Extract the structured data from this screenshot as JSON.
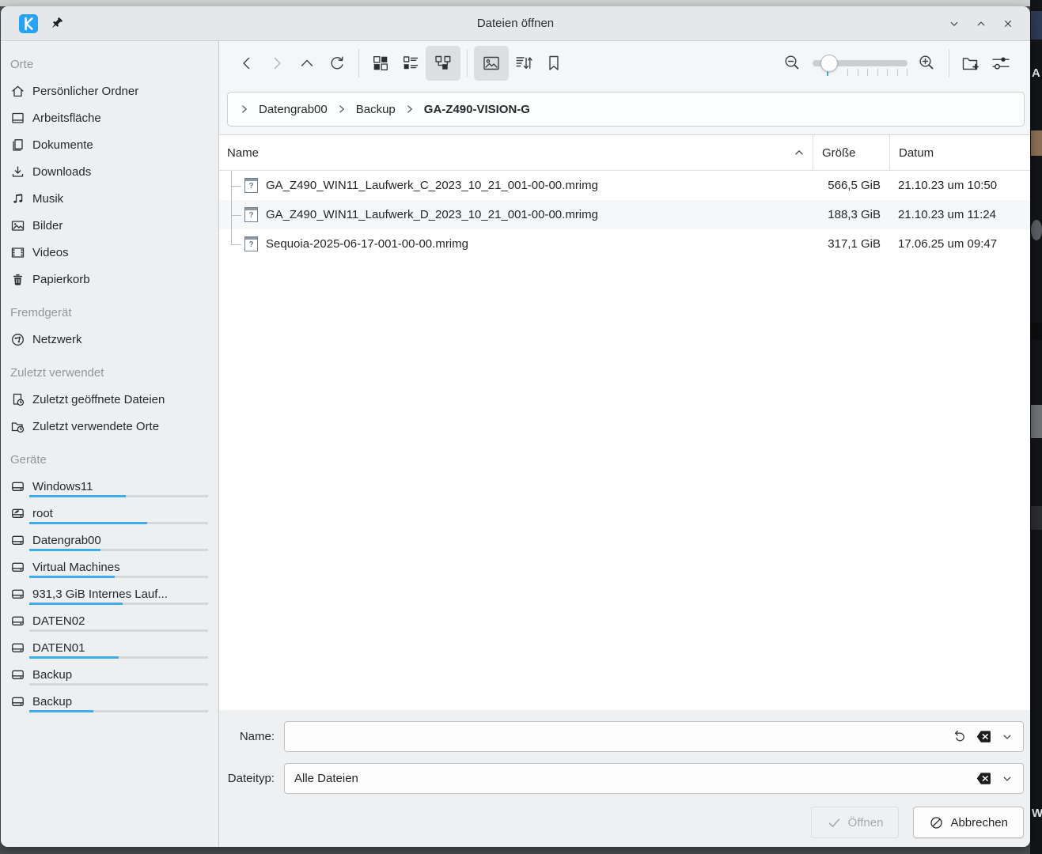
{
  "window": {
    "title": "Dateien öffnen"
  },
  "titlebar": {
    "controls": [
      {
        "name": "minimize",
        "icon": "chevron-down"
      },
      {
        "name": "maximize",
        "icon": "chevron-up"
      },
      {
        "name": "close",
        "icon": "close"
      }
    ]
  },
  "toolbar": {
    "buttons_left": [
      {
        "name": "back",
        "icon": "back",
        "state": "normal"
      },
      {
        "name": "forward",
        "icon": "forward",
        "state": "disabled"
      },
      {
        "name": "up",
        "icon": "up",
        "state": "normal"
      },
      {
        "name": "refresh",
        "icon": "refresh",
        "state": "normal"
      },
      {
        "name": "separator"
      },
      {
        "name": "icon-view",
        "icon": "view-icons",
        "state": "normal"
      },
      {
        "name": "compact-view",
        "icon": "view-compact",
        "state": "normal"
      },
      {
        "name": "detail-tree-view",
        "icon": "view-tree",
        "state": "pressed"
      },
      {
        "name": "separator"
      },
      {
        "name": "preview",
        "icon": "preview",
        "state": "pressed"
      },
      {
        "name": "sort",
        "icon": "sort",
        "state": "normal"
      },
      {
        "name": "bookmark",
        "icon": "bookmark",
        "state": "normal"
      }
    ],
    "buttons_right": [
      {
        "name": "zoom-out",
        "icon": "zoom-out",
        "state": "normal"
      },
      {
        "name": "zoom-slider",
        "slider": true,
        "value": 0.1
      },
      {
        "name": "zoom-in",
        "icon": "zoom-in",
        "state": "normal"
      },
      {
        "name": "separator"
      },
      {
        "name": "new-folder",
        "icon": "new-folder",
        "state": "normal"
      },
      {
        "name": "options",
        "icon": "options",
        "state": "normal"
      }
    ]
  },
  "breadcrumb": {
    "items": [
      {
        "label": "Datengrab00",
        "current": false
      },
      {
        "label": "Backup",
        "current": false
      },
      {
        "label": "GA-Z490-VISION-G",
        "current": true
      }
    ]
  },
  "list": {
    "columns": [
      {
        "label": "Name",
        "sort": "asc"
      },
      {
        "label": "Größe"
      },
      {
        "label": "Datum"
      }
    ],
    "rows": [
      {
        "name": "GA_Z490_WIN11_Laufwerk_C_2023_10_21_001-00-00.mrimg",
        "size": "566,5 GiB",
        "date": "21.10.23 um 10:50"
      },
      {
        "name": "GA_Z490_WIN11_Laufwerk_D_2023_10_21_001-00-00.mrimg",
        "size": "188,3 GiB",
        "date": "21.10.23 um 11:24"
      },
      {
        "name": "Sequoia-2025-06-17-001-00-00.mrimg",
        "size": "317,1 GiB",
        "date": "17.06.25 um 09:47"
      }
    ]
  },
  "sidebar": {
    "sections": [
      {
        "header": "Orte",
        "items": [
          {
            "label": "Persönlicher Ordner",
            "icon": "home"
          },
          {
            "label": "Arbeitsfläche",
            "icon": "desktop"
          },
          {
            "label": "Dokumente",
            "icon": "documents"
          },
          {
            "label": "Downloads",
            "icon": "download"
          },
          {
            "label": "Musik",
            "icon": "music"
          },
          {
            "label": "Bilder",
            "icon": "image"
          },
          {
            "label": "Videos",
            "icon": "video"
          },
          {
            "label": "Papierkorb",
            "icon": "trash"
          }
        ]
      },
      {
        "header": "Fremdgerät",
        "items": [
          {
            "label": "Netzwerk",
            "icon": "network"
          }
        ]
      },
      {
        "header": "Zuletzt verwendet",
        "items": [
          {
            "label": "Zuletzt geöffnete Dateien",
            "icon": "file-clock"
          },
          {
            "label": "Zuletzt verwendete Orte",
            "icon": "folder-clock"
          }
        ]
      },
      {
        "header": "Geräte",
        "items": [
          {
            "label": "Windows11",
            "icon": "drive",
            "usage": 0.54
          },
          {
            "label": "root",
            "icon": "drive-root",
            "usage": 0.66
          },
          {
            "label": "Datengrab00",
            "icon": "drive",
            "usage": 0.4
          },
          {
            "label": "Virtual Machines",
            "icon": "drive",
            "usage": 0.48
          },
          {
            "label": "931,3 GiB Internes Lauf...",
            "icon": "drive",
            "usage": 0.52
          },
          {
            "label": "DATEN02",
            "icon": "drive",
            "usage": 0
          },
          {
            "label": "DATEN01",
            "icon": "drive",
            "usage": 0.5
          },
          {
            "label": "Backup",
            "icon": "drive",
            "usage": 0
          },
          {
            "label": "Backup",
            "icon": "drive",
            "usage": 0.36
          }
        ]
      }
    ]
  },
  "footer": {
    "name_label": "Name:",
    "name_value": "",
    "filetype_label": "Dateityp:",
    "filetype_value": "Alle Dateien",
    "open_label": "Öffnen",
    "cancel_label": "Abbrechen"
  },
  "icons": {
    "unknown_file_glyph": "?",
    "kde_logo_letter": "K"
  },
  "colors": {
    "accent": "#3daee9",
    "titlebar": "#e5e7e8",
    "window": "#eef0f1",
    "alt_row": "#f6f7f8"
  },
  "background": {
    "fragments": [
      "A",
      "W"
    ]
  }
}
